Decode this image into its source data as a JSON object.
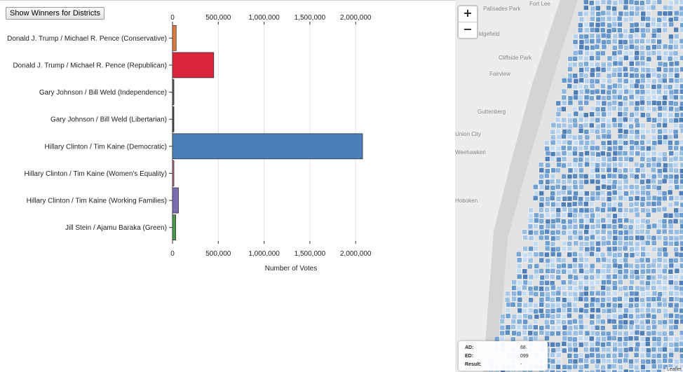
{
  "controls": {
    "show_winners_label": "Show Winners for Districts"
  },
  "chart_data": {
    "type": "bar",
    "orientation": "horizontal",
    "categories": [
      "Donald J. Trump / Michael R. Pence (Conservative)",
      "Donald J. Trump / Michael R. Pence (Republican)",
      "Gary Johnson / Bill Weld (Independence)",
      "Gary Johnson / Bill Weld (Libertarian)",
      "Hillary Clinton / Tim Kaine (Democratic)",
      "Hillary Clinton / Tim Kaine (Women's Equality)",
      "Hillary Clinton / Tim Kaine (Working Families)",
      "Jill Stein / Ajamu Baraka (Green)"
    ],
    "values": [
      40000,
      450000,
      15000,
      8000,
      2075000,
      8000,
      65000,
      35000
    ],
    "colors": [
      "#e07b39",
      "#d9263a",
      "#555555",
      "#444444",
      "#4a7fbb",
      "#c2708a",
      "#7b6bb0",
      "#4a9a4a"
    ],
    "xlabel": "Number of Votes",
    "xlim": [
      0,
      2100000
    ],
    "xticks": [
      "0",
      "500,000",
      "1,000,000",
      "1,500,000",
      "2,000,000"
    ],
    "grid": true
  },
  "map": {
    "zoom_in": "+",
    "zoom_out": "−",
    "place_labels": [
      "Palisades Park",
      "Fort Lee",
      "Ridgefield",
      "Cliffside Park",
      "Fairview",
      "Guttenberg",
      "Union City",
      "Weehawken",
      "Hoboken"
    ],
    "attribution": "Leaflet",
    "info": [
      {
        "key": "AD:",
        "value": "68"
      },
      {
        "key": "ED:",
        "value": "099"
      },
      {
        "key": "Result:",
        "value": "-"
      }
    ]
  }
}
